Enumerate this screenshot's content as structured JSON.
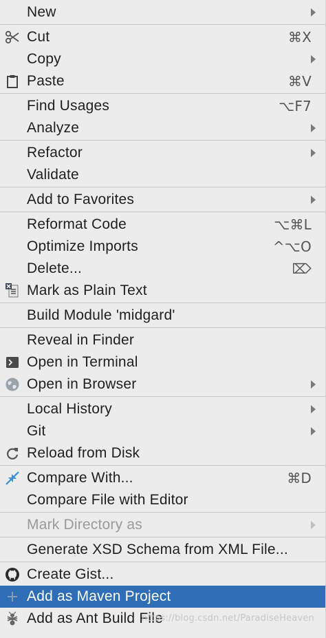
{
  "menu": {
    "new": "New",
    "cut": "Cut",
    "cut_shortcut": "⌘X",
    "copy": "Copy",
    "paste": "Paste",
    "paste_shortcut": "⌘V",
    "find_usages": "Find Usages",
    "find_usages_shortcut": "⌥F7",
    "analyze": "Analyze",
    "refactor": "Refactor",
    "validate": "Validate",
    "add_to_favorites": "Add to Favorites",
    "reformat_code": "Reformat Code",
    "reformat_code_shortcut": "⌥⌘L",
    "optimize_imports": "Optimize Imports",
    "optimize_imports_shortcut": "^⌥O",
    "delete": "Delete...",
    "delete_shortcut": "⌦",
    "mark_plain_text": "Mark as Plain Text",
    "build_module": "Build Module 'midgard'",
    "reveal_in_finder": "Reveal in Finder",
    "open_in_terminal": "Open in Terminal",
    "open_in_browser": "Open in Browser",
    "local_history": "Local History",
    "git": "Git",
    "reload_from_disk": "Reload from Disk",
    "compare_with": "Compare With...",
    "compare_with_shortcut": "⌘D",
    "compare_file_with_editor": "Compare File with Editor",
    "mark_directory_as": "Mark Directory as",
    "generate_xsd": "Generate XSD Schema from XML File...",
    "create_gist": "Create Gist...",
    "add_maven_project": "Add as Maven Project",
    "add_ant_build_file": "Add as Ant Build File",
    "watermark": "https://blog.csdn.net/ParadiseHeaven"
  },
  "colors": {
    "background": "#ececec",
    "selected": "#2f6eb7",
    "separator": "#c9c9c9",
    "disabled_text": "#9a9a9a"
  }
}
